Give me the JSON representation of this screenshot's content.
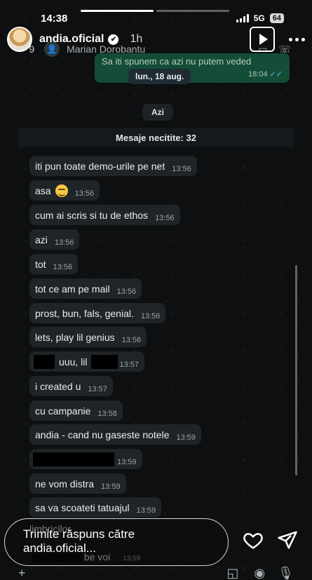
{
  "status": {
    "time": "14:38",
    "network": "5G",
    "battery": "64"
  },
  "story": {
    "username": "andia.oficial",
    "verified_mark": "✔",
    "age": "1h",
    "progress": [
      1.0,
      0.0
    ]
  },
  "chat": {
    "back_count": "9",
    "contact_name": "Marian Dorobantu",
    "outgoing": {
      "partial_text": "Sa iti spunem ca azi nu putem veded",
      "time": "18:04",
      "ticks": "✓✓"
    },
    "date_label": "lun., 18 aug.",
    "today_label": "Azi",
    "unread_label": "Mesaje necitite: 32",
    "messages": [
      {
        "text": "iti pun toate demo-urile pe net",
        "time": "13:56"
      },
      {
        "text": "asa",
        "time": "13:56"
      },
      {
        "text": "cum ai scris si tu de ethos",
        "time": "13:56"
      },
      {
        "text": "azi",
        "time": "13:56"
      },
      {
        "text": "tot",
        "time": "13:56"
      },
      {
        "text": "tot ce am pe mail",
        "time": "13:56"
      },
      {
        "text": "prost, bun, fals, genial.",
        "time": "13:56"
      },
      {
        "text": "lets, play lil genius",
        "time": "13:56"
      },
      {
        "text_mid": "uuu, lil",
        "time": "13:57"
      },
      {
        "text": "i created u",
        "time": "13:57"
      },
      {
        "text": "cu campanie",
        "time": "13:58"
      },
      {
        "text": "andia - cand nu gaseste notele",
        "time": "13:59"
      },
      {
        "time": "13:59"
      },
      {
        "text": "ne vom distra",
        "time": "13:59"
      },
      {
        "text": "sa va scoateti tatuajul",
        "time": "13:59"
      }
    ],
    "behind_reply": [
      "limbricilor",
      "be voi",
      "13:59"
    ]
  },
  "reply": {
    "line1": "Trimite răspuns către",
    "line2": "andia.oficial..."
  }
}
